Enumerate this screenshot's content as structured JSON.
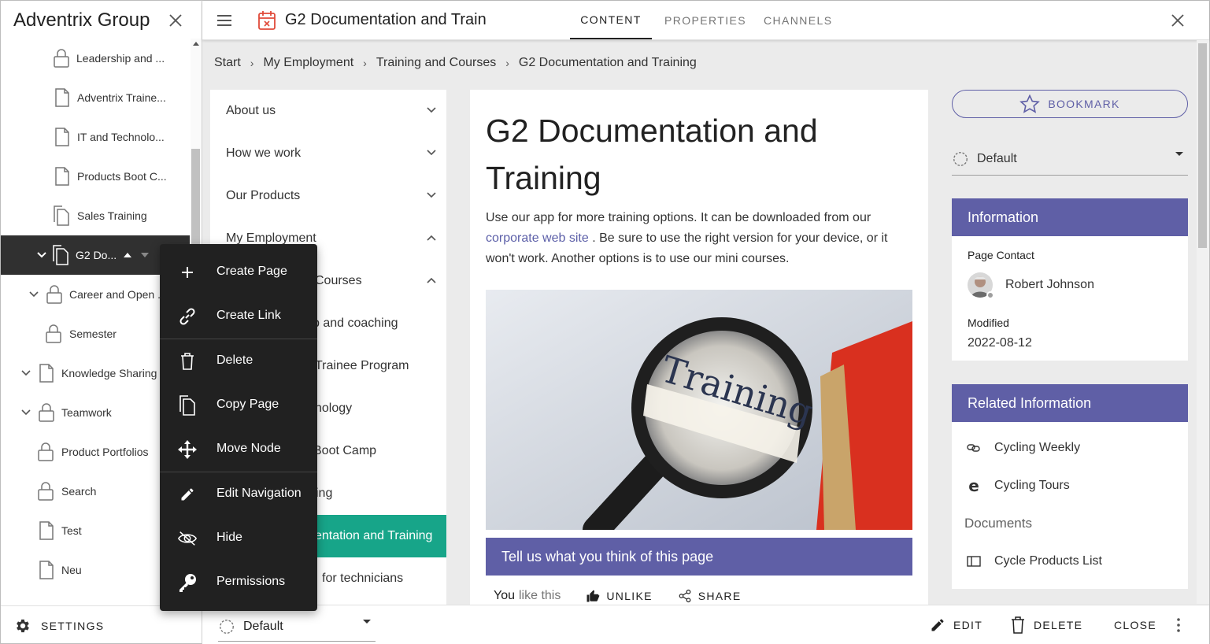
{
  "left_panel": {
    "title": "Adventrix Group",
    "tree": [
      {
        "label": "Leadership and ...",
        "icon": "lock-icon"
      },
      {
        "label": "Adventrix Traine...",
        "icon": "page-icon"
      },
      {
        "label": "IT and Technolo...",
        "icon": "page-icon"
      },
      {
        "label": "Products Boot C...",
        "icon": "page-icon"
      },
      {
        "label": "Sales Training",
        "icon": "copy-page-icon"
      },
      {
        "label": "G2 Do...",
        "icon": "copy-page-icon",
        "selected": true
      },
      {
        "label": "Career and Open ...",
        "icon": "lock-icon"
      },
      {
        "label": "Semester",
        "icon": "lock-icon"
      },
      {
        "label": "Knowledge Sharing",
        "icon": "page-icon"
      },
      {
        "label": "Teamwork",
        "icon": "lock-icon"
      },
      {
        "label": "Product Portfolios",
        "icon": "lock-icon"
      },
      {
        "label": "Search",
        "icon": "lock-icon"
      },
      {
        "label": "Test",
        "icon": "page-icon"
      },
      {
        "label": "Neu",
        "icon": "page-icon"
      }
    ],
    "settings_label": "SETTINGS"
  },
  "context_menu": {
    "items": [
      {
        "label": "Create Page",
        "icon": "plus-icon"
      },
      {
        "label": "Create Link",
        "icon": "link-icon"
      },
      {
        "label": "Delete",
        "icon": "trash-icon"
      },
      {
        "label": "Copy Page",
        "icon": "copy-icon"
      },
      {
        "label": "Move Node",
        "icon": "move-icon"
      },
      {
        "label": "Edit Navigation",
        "icon": "pencil-icon"
      },
      {
        "label": "Hide",
        "icon": "eye-off-icon"
      },
      {
        "label": "Permissions",
        "icon": "key-icon"
      }
    ]
  },
  "topbar": {
    "title": "G2 Documentation and Train",
    "tabs": [
      {
        "label": "CONTENT",
        "active": true
      },
      {
        "label": "PROPERTIES",
        "active": false
      },
      {
        "label": "CHANNELS",
        "active": false
      }
    ]
  },
  "breadcrumb": [
    "Start",
    "My Employment",
    "Training and Courses",
    "G2 Documentation and Training"
  ],
  "inner_nav": [
    {
      "label": "About us",
      "chevron": "down"
    },
    {
      "label": "How we work",
      "chevron": "down"
    },
    {
      "label": "Our Products",
      "chevron": "down"
    },
    {
      "label": "My Employment",
      "chevron": "up"
    },
    {
      "label": "Courses",
      "chevron": "up"
    },
    {
      "label": "p and coaching",
      "chevron": ""
    },
    {
      "label": "Trainee Program",
      "chevron": ""
    },
    {
      "label": "nology",
      "chevron": ""
    },
    {
      "label": "Boot Camp",
      "chevron": ""
    },
    {
      "label": "ing",
      "chevron": ""
    },
    {
      "label": "entation and Training",
      "chevron": "",
      "active": true
    },
    {
      "label": "for technicians",
      "chevron": ""
    }
  ],
  "content": {
    "title": "G2 Documentation and Training",
    "body_before_link": "Use our app for more training options. It can be downloaded from our",
    "link_text": "corporate web site",
    "body_after_link": ". Be sure to use the right version for your device, or it won't work. Another options is to use our mini courses.",
    "image_caption_word": "Training",
    "feedback_title": "Tell us what you think of this page",
    "you_label": "You",
    "like_text": "like this",
    "unlike_label": "UNLIKE",
    "share_label": "SHARE"
  },
  "right": {
    "bookmark_label": "BOOKMARK",
    "select_value": "Default",
    "info": {
      "header": "Information",
      "contact_label": "Page Contact",
      "contact_name": "Robert Johnson",
      "modified_label": "Modified",
      "modified_value": "2022-08-12"
    },
    "related": {
      "header": "Related Information",
      "links": [
        {
          "label": "Cycling Weekly",
          "icon": "link-icon"
        },
        {
          "label": "Cycling Tours",
          "icon": "edge-browser-icon"
        }
      ],
      "documents_label": "Documents",
      "documents": [
        {
          "label": "Cycle Products List",
          "icon": "book-icon"
        }
      ]
    }
  },
  "bottombar": {
    "select_value": "Default",
    "edit_label": "EDIT",
    "delete_label": "DELETE",
    "close_label": "CLOSE"
  },
  "colors": {
    "accent": "#5f5fa6",
    "active_nav": "#17a589",
    "selected_tree": "#303030"
  }
}
